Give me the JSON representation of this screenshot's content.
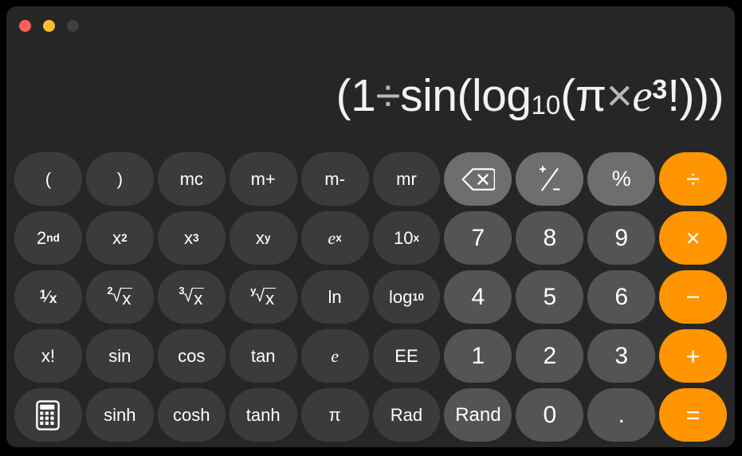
{
  "window": {
    "traffic_lights": [
      {
        "name": "close",
        "color": "#FF5F57",
        "label": "Close"
      },
      {
        "name": "minimize",
        "color": "#FEBC2E",
        "label": "Minimize"
      },
      {
        "name": "zoom",
        "color": "#3f3f3f",
        "label": "Zoom"
      }
    ]
  },
  "display": {
    "expression": "(1÷sin(log10(π×e3!)))",
    "expression_plain": "(1÷sin(log₁₀(π×e³!)))"
  },
  "colors": {
    "window_background": "#262626",
    "function_key": "#3b3b3b",
    "utility_key": "#6e6e6e",
    "number_key": "#545454",
    "operator_key": "#FF9500",
    "key_text": "#ffffff",
    "display_text": "#f2f2f2"
  },
  "keypad": {
    "rows": [
      [
        {
          "id": "open-paren",
          "label": "(",
          "style": "fn",
          "kind": "text"
        },
        {
          "id": "close-paren",
          "label": ")",
          "style": "fn",
          "kind": "text"
        },
        {
          "id": "memory-clear",
          "label": "mc",
          "style": "fn",
          "kind": "text"
        },
        {
          "id": "memory-add",
          "label": "m+",
          "style": "fn",
          "kind": "text"
        },
        {
          "id": "memory-subtract",
          "label": "m-",
          "style": "fn",
          "kind": "text"
        },
        {
          "id": "memory-recall",
          "label": "mr",
          "style": "fn",
          "kind": "text"
        },
        {
          "id": "delete",
          "label": "delete-icon",
          "style": "util",
          "kind": "icon"
        },
        {
          "id": "plus-minus",
          "label": "+/-",
          "style": "util",
          "kind": "plusminus"
        },
        {
          "id": "percent",
          "label": "%",
          "style": "util",
          "kind": "text"
        },
        {
          "id": "divide",
          "label": "÷",
          "style": "op",
          "kind": "text"
        }
      ],
      [
        {
          "id": "second",
          "label": "2nd",
          "style": "fn",
          "kind": "sup",
          "base": "2",
          "exp": "nd"
        },
        {
          "id": "x-squared",
          "label": "x2",
          "style": "fn",
          "kind": "sup",
          "base": "x",
          "exp": "2"
        },
        {
          "id": "x-cubed",
          "label": "x3",
          "style": "fn",
          "kind": "sup",
          "base": "x",
          "exp": "3"
        },
        {
          "id": "x-to-the-y",
          "label": "xy",
          "style": "fn",
          "kind": "sup",
          "base": "x",
          "exp": "y"
        },
        {
          "id": "e-to-the-x",
          "label": "ex",
          "style": "fn",
          "kind": "supi",
          "base": "e",
          "exp": "x"
        },
        {
          "id": "ten-to-the-x",
          "label": "10x",
          "style": "fn",
          "kind": "sup",
          "base": "10",
          "exp": "x"
        },
        {
          "id": "seven",
          "label": "7",
          "style": "num",
          "kind": "text"
        },
        {
          "id": "eight",
          "label": "8",
          "style": "num",
          "kind": "text"
        },
        {
          "id": "nine",
          "label": "9",
          "style": "num",
          "kind": "text"
        },
        {
          "id": "multiply",
          "label": "×",
          "style": "op",
          "kind": "text"
        }
      ],
      [
        {
          "id": "reciprocal",
          "label": "1/x",
          "style": "fn",
          "kind": "frac",
          "base": "1",
          "exp": "x"
        },
        {
          "id": "square-root",
          "label": "2√x",
          "style": "fn",
          "kind": "root",
          "index": "2",
          "radicand": "x"
        },
        {
          "id": "cube-root",
          "label": "3√x",
          "style": "fn",
          "kind": "root",
          "index": "3",
          "radicand": "x"
        },
        {
          "id": "y-root",
          "label": "y√x",
          "style": "fn",
          "kind": "root",
          "index": "y",
          "radicand": "x"
        },
        {
          "id": "natural-log",
          "label": "ln",
          "style": "fn",
          "kind": "text"
        },
        {
          "id": "log-base-10",
          "label": "log10",
          "style": "fn",
          "kind": "subs",
          "base": "log",
          "sub": "10"
        },
        {
          "id": "four",
          "label": "4",
          "style": "num",
          "kind": "text"
        },
        {
          "id": "five",
          "label": "5",
          "style": "num",
          "kind": "text"
        },
        {
          "id": "six",
          "label": "6",
          "style": "num",
          "kind": "text"
        },
        {
          "id": "subtract",
          "label": "−",
          "style": "op",
          "kind": "text"
        }
      ],
      [
        {
          "id": "factorial",
          "label": "x!",
          "style": "fn",
          "kind": "text"
        },
        {
          "id": "sine",
          "label": "sin",
          "style": "fn",
          "kind": "text"
        },
        {
          "id": "cosine",
          "label": "cos",
          "style": "fn",
          "kind": "text"
        },
        {
          "id": "tangent",
          "label": "tan",
          "style": "fn",
          "kind": "text"
        },
        {
          "id": "euler-e",
          "label": "e",
          "style": "fn",
          "kind": "ital"
        },
        {
          "id": "exponent-ee",
          "label": "EE",
          "style": "fn",
          "kind": "text"
        },
        {
          "id": "one",
          "label": "1",
          "style": "num",
          "kind": "text"
        },
        {
          "id": "two",
          "label": "2",
          "style": "num",
          "kind": "text"
        },
        {
          "id": "three",
          "label": "3",
          "style": "num",
          "kind": "text"
        },
        {
          "id": "add",
          "label": "+",
          "style": "op",
          "kind": "text"
        }
      ],
      [
        {
          "id": "calculator-mode",
          "label": "calculator-icon",
          "style": "fn",
          "kind": "icon"
        },
        {
          "id": "hyperbolic-sine",
          "label": "sinh",
          "style": "fn",
          "kind": "text"
        },
        {
          "id": "hyperbolic-cos",
          "label": "cosh",
          "style": "fn",
          "kind": "text"
        },
        {
          "id": "hyperbolic-tan",
          "label": "tanh",
          "style": "fn",
          "kind": "text"
        },
        {
          "id": "pi",
          "label": "π",
          "style": "fn",
          "kind": "text"
        },
        {
          "id": "radians",
          "label": "Rad",
          "style": "fn",
          "kind": "text"
        },
        {
          "id": "random",
          "label": "Rand",
          "style": "num",
          "kind": "text",
          "size": "small"
        },
        {
          "id": "zero",
          "label": "0",
          "style": "num",
          "kind": "text"
        },
        {
          "id": "decimal-point",
          "label": ".",
          "style": "num",
          "kind": "text"
        },
        {
          "id": "equals",
          "label": "=",
          "style": "op",
          "kind": "text"
        }
      ]
    ]
  }
}
